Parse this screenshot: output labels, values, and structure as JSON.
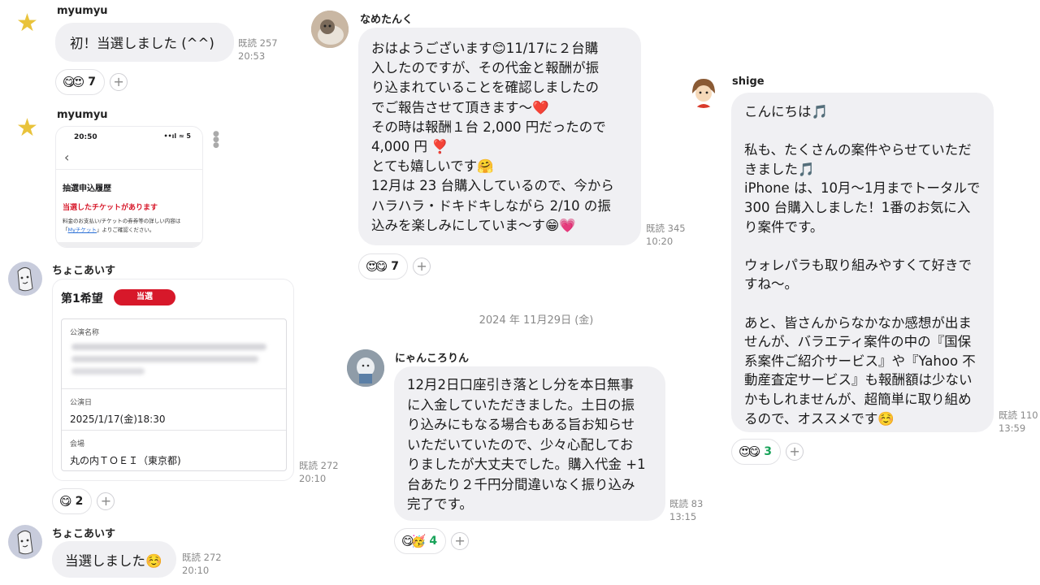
{
  "col1": {
    "msg1": {
      "name": "myumyu",
      "text": "初！当選しました (^^)",
      "read": "既読 257",
      "time": "20:53",
      "reactions": "😋😍",
      "count": "7"
    },
    "msg2": {
      "name": "myumyu",
      "phone": {
        "time": "20:50",
        "status": "••ıl ≈ 5",
        "back": "‹",
        "heading": "抽選申込履歴",
        "alert": "当選したチケットがあります",
        "note1": "料金のお支払い/チケットの券券等の詳しい内容は",
        "note2_pre": "「",
        "note2_link": "Myチケット",
        "note2_post": "」よりご確認ください。"
      }
    },
    "msg3": {
      "name": "ちょこあいす",
      "card": {
        "title": "第1希望",
        "badge": "当選",
        "label1": "公演名称",
        "label2": "公演日",
        "date": "2025/1/17(金)18:30",
        "label3": "会場",
        "venue": "丸の内ＴＯＥＩ（東京都)"
      },
      "read": "既読 272",
      "time": "20:10",
      "reactions": "😋",
      "count": "2"
    },
    "msg4": {
      "name": "ちょこあいす",
      "text": "当選しました☺️",
      "read": "既読 272",
      "time": "20:10"
    }
  },
  "col2": {
    "msg1": {
      "name": "なめたんく",
      "text": "おはようございます😊11/17に２台購\n入したのですが、その代金と報酬が振\nり込まれていることを確認しましたの\nでご報告させて頂きます〜❤️\nその時は報酬１台 2,000 円だったので\n4,000 円 ❣️\nとても嬉しいです🤗\n12月は 23 台購入しているので、今から\nハラハラ・ドキドキしながら 2/10 の振\n込みを楽しみにしていま〜す😁💗",
      "read": "既読 345",
      "time": "10:20",
      "reactions": "😍😋",
      "count": "7"
    },
    "date_divider": "2024 年 11月29日 (金)",
    "msg2": {
      "name": "にゃんころりん",
      "text": "12月2日口座引き落とし分を本日無事\nに入金していただきました。土日の振\nり込みにもなる場合もある旨お知らせ\nいただいていたので、少々心配してお\nりましたが大丈夫でした。購入代金 +1\n台あたり２千円分間違いなく振り込み\n完了です。",
      "read": "既読 83",
      "time": "13:15",
      "reactions": "😋🥳",
      "count": "4"
    }
  },
  "col3": {
    "msg1": {
      "name": "shige",
      "text": "こんにちは🎵\n\n私も、たくさんの案件やらせていただ\nきました🎵\niPhone は、10月〜1月までトータルで\n300 台購入しました！1番のお気に入\nり案件です。\n\nウォレパラも取り組みやすくて好きで\nすね〜。\n\nあと、皆さんからなかなか感想が出ま\nせんが、バラエティ案件の中の『国保\n系案件ご紹介サービス』や『Yahoo 不\n動産査定サービス』も報酬額は少ない\nかもしれませんが、超簡単に取り組め\nるので、オススメです☺️",
      "read": "既読 110",
      "time": "13:59",
      "reactions": "😍😋",
      "count": "3"
    }
  },
  "colors": {
    "bubble": "#f0f0f3",
    "badge": "#d7182a",
    "green": "#19a35a",
    "star": "#e9c33b"
  }
}
